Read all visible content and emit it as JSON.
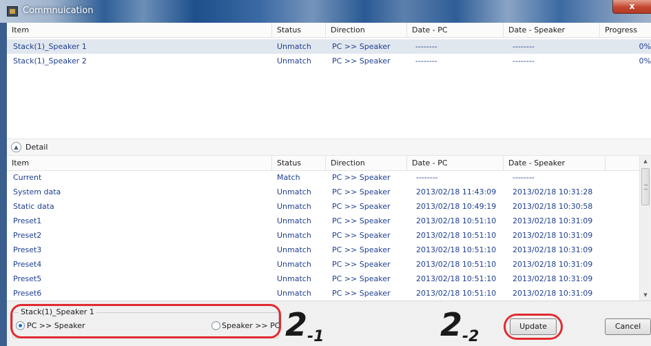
{
  "window": {
    "title": "Commnuication",
    "close_label": "x"
  },
  "top_list": {
    "headers": {
      "item": "Item",
      "status": "Status",
      "direction": "Direction",
      "date_pc": "Date - PC",
      "date_speaker": "Date - Speaker",
      "progress": "Progress"
    },
    "rows": [
      {
        "item": "Stack(1)_Speaker 1",
        "status": "Unmatch",
        "direction": "PC >> Speaker",
        "date_pc": "--------",
        "date_speaker": "--------",
        "progress": "0%",
        "selected": true
      },
      {
        "item": "Stack(1)_Speaker 2",
        "status": "Unmatch",
        "direction": "PC >> Speaker",
        "date_pc": "--------",
        "date_speaker": "--------",
        "progress": "0%",
        "selected": false
      }
    ]
  },
  "detail": {
    "label": "Detail",
    "toggle_icon": "chevron-up-icon",
    "headers": {
      "item": "Item",
      "status": "Status",
      "direction": "Direction",
      "date_pc": "Date - PC",
      "date_speaker": "Date - Speaker"
    },
    "rows": [
      {
        "item": "Current",
        "status": "Match",
        "direction": "PC >> Speaker",
        "date_pc": "--------",
        "date_speaker": "--------"
      },
      {
        "item": "System data",
        "status": "Unmatch",
        "direction": "PC >> Speaker",
        "date_pc": "2013/02/18 11:43:09",
        "date_speaker": "2013/02/18 10:31:28"
      },
      {
        "item": "Static data",
        "status": "Unmatch",
        "direction": "PC >> Speaker",
        "date_pc": "2013/02/18 10:49:19",
        "date_speaker": "2013/02/18 10:30:58"
      },
      {
        "item": "Preset1",
        "status": "Unmatch",
        "direction": "PC >> Speaker",
        "date_pc": "2013/02/18 10:51:10",
        "date_speaker": "2013/02/18 10:31:09"
      },
      {
        "item": "Preset2",
        "status": "Unmatch",
        "direction": "PC >> Speaker",
        "date_pc": "2013/02/18 10:51:10",
        "date_speaker": "2013/02/18 10:31:09"
      },
      {
        "item": "Preset3",
        "status": "Unmatch",
        "direction": "PC >> Speaker",
        "date_pc": "2013/02/18 10:51:10",
        "date_speaker": "2013/02/18 10:31:09"
      },
      {
        "item": "Preset4",
        "status": "Unmatch",
        "direction": "PC >> Speaker",
        "date_pc": "2013/02/18 10:51:10",
        "date_speaker": "2013/02/18 10:31:09"
      },
      {
        "item": "Preset5",
        "status": "Unmatch",
        "direction": "PC >> Speaker",
        "date_pc": "2013/02/18 10:51:10",
        "date_speaker": "2013/02/18 10:31:09"
      },
      {
        "item": "Preset6",
        "status": "Unmatch",
        "direction": "PC >> Speaker",
        "date_pc": "2013/02/18 10:51:10",
        "date_speaker": "2013/02/18 10:31:09"
      }
    ]
  },
  "bottom": {
    "group_title": "Stack(1)_Speaker 1",
    "radio_pc_to_speaker": "PC >> Speaker",
    "radio_speaker_to_pc": "Speaker >> PC",
    "selected_direction": "PC >> Speaker",
    "update_label": "Update",
    "cancel_label": "Cancel"
  },
  "annotations": {
    "callout_1_main": "2",
    "callout_1_sub": "-1",
    "callout_2_main": "2",
    "callout_2_sub": "-2",
    "ring_color": "#e12a2f"
  },
  "colors": {
    "accent_text": "#1d3e8f",
    "selected_row": "#e1e7ef",
    "titlebar": "#2f5e97"
  }
}
